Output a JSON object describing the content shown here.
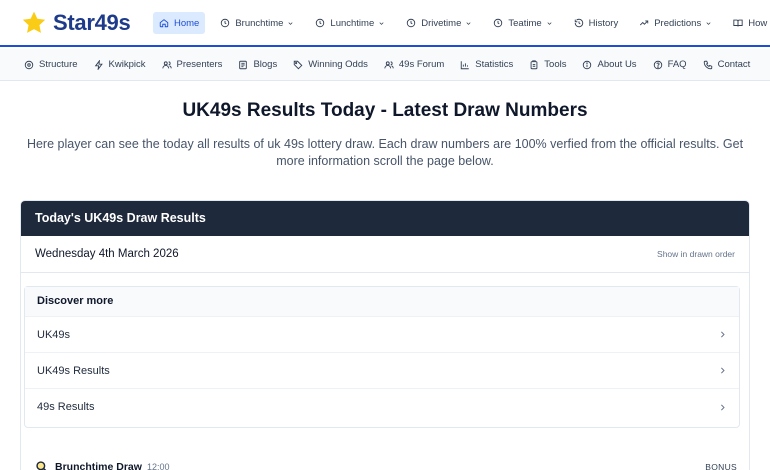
{
  "header": {
    "logo_text": "Star49s",
    "accent_color": "#1d4ed8",
    "nav": [
      {
        "label": "Home",
        "icon": "home-icon",
        "active": true
      },
      {
        "label": "Brunchtime",
        "icon": "clock-icon",
        "dropdown": true
      },
      {
        "label": "Lunchtime",
        "icon": "clock-icon",
        "dropdown": true
      },
      {
        "label": "Drivetime",
        "icon": "clock-icon",
        "dropdown": true
      },
      {
        "label": "Teatime",
        "icon": "clock-icon",
        "dropdown": true
      },
      {
        "label": "History",
        "icon": "history-icon"
      },
      {
        "label": "Predictions",
        "icon": "trending-up-icon",
        "dropdown": true
      },
      {
        "label": "How to Play",
        "icon": "book-icon"
      }
    ]
  },
  "subnav": [
    {
      "label": "Structure",
      "icon": "structure-icon"
    },
    {
      "label": "Kwikpick",
      "icon": "lightning-icon"
    },
    {
      "label": "Presenters",
      "icon": "users-icon"
    },
    {
      "label": "Blogs",
      "icon": "document-icon"
    },
    {
      "label": "Winning Odds",
      "icon": "tag-icon"
    },
    {
      "label": "49s Forum",
      "icon": "forum-icon"
    },
    {
      "label": "Statistics",
      "icon": "bar-chart-icon"
    },
    {
      "label": "Tools",
      "icon": "clipboard-icon"
    },
    {
      "label": "About Us",
      "icon": "info-icon"
    },
    {
      "label": "FAQ",
      "icon": "help-icon"
    },
    {
      "label": "Contact",
      "icon": "phone-icon"
    }
  ],
  "main": {
    "title": "UK49s Results Today - Latest Draw Numbers",
    "intro": "Here player can see the today all results of uk 49s lottery draw. Each draw numbers are 100% verfied from the official results. Get more information scroll the page below."
  },
  "results_card": {
    "header": "Today's UK49s Draw Results",
    "date": "Wednesday 4th March 2026",
    "order_link": "Show in drawn order",
    "discover": {
      "title": "Discover more",
      "items": [
        "UK49s",
        "UK49s Results",
        "49s Results"
      ]
    },
    "draw": {
      "name": "Brunchtime Draw",
      "time": "12:00",
      "bonus_label": "BONUS"
    }
  }
}
